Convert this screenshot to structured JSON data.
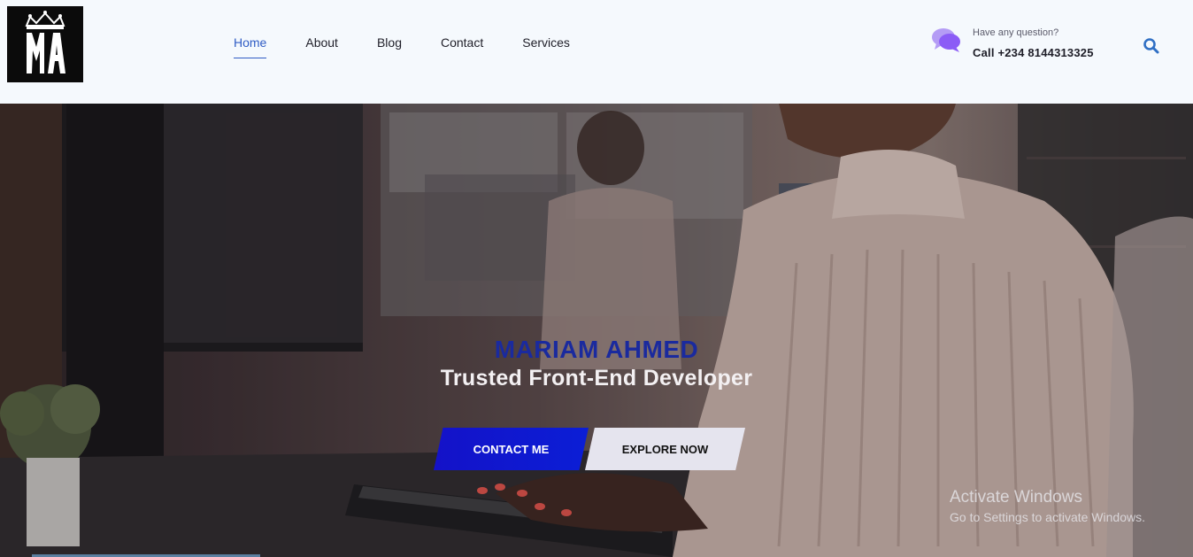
{
  "brand": {
    "logo_text": "MA"
  },
  "nav": {
    "items": [
      {
        "label": "Home",
        "active": true
      },
      {
        "label": "About"
      },
      {
        "label": "Blog"
      },
      {
        "label": "Contact"
      },
      {
        "label": "Services"
      }
    ]
  },
  "contact": {
    "question": "Have any question?",
    "phone": "Call +234 8144313325",
    "icon": "chat-bubbles-icon"
  },
  "search": {
    "icon": "search-icon"
  },
  "hero": {
    "title": "MARIAM AHMED",
    "subtitle": "Trusted Front-End Developer",
    "primary_button": "CONTACT ME",
    "secondary_button": "EXPLORE NOW"
  },
  "windows_watermark": {
    "title": "Activate Windows",
    "subtitle": "Go to Settings to activate Windows."
  },
  "colors": {
    "accent": "#2f5cc4",
    "primary_button": "#0b1ed6",
    "hero_title": "#1a2a9e",
    "header_bg": "#f5f9fd",
    "chat_icon": "#8b5cf6"
  }
}
